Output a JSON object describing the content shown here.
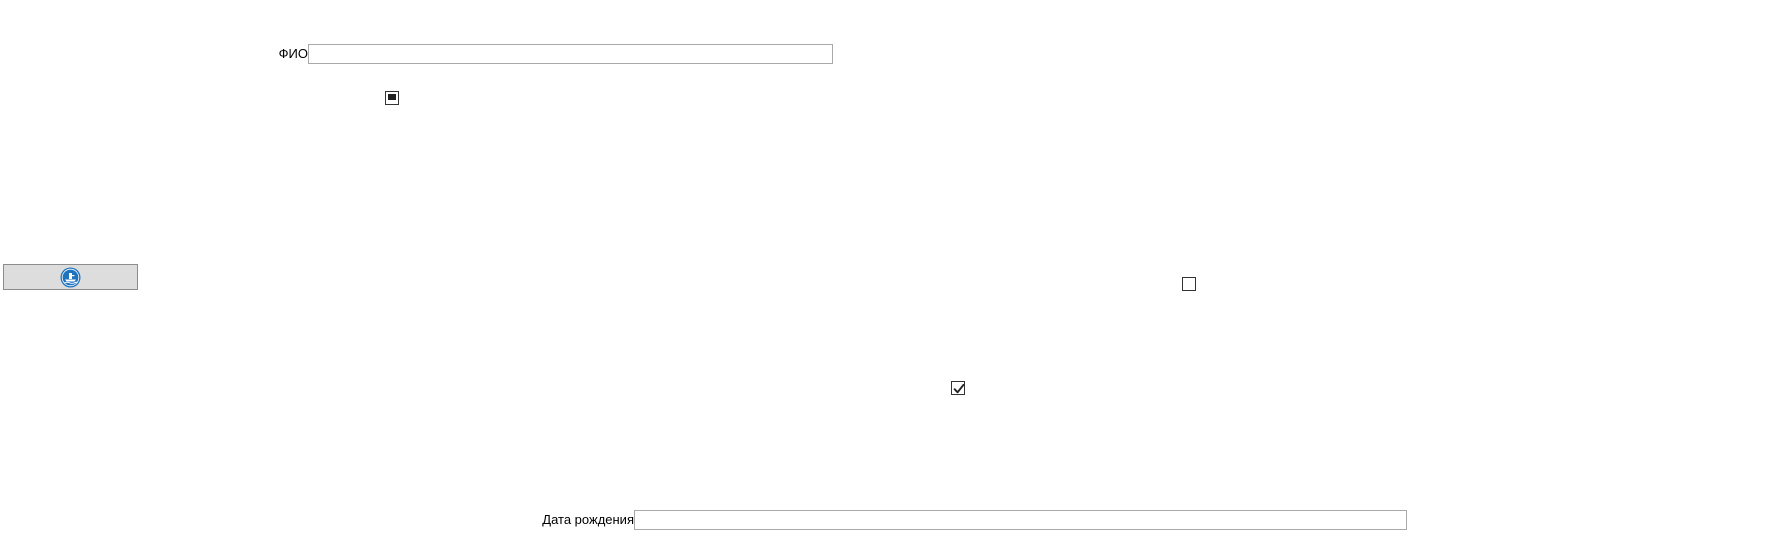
{
  "form": {
    "full_name": {
      "label": "ФИО",
      "value": ""
    },
    "birth_date": {
      "label": "Дата рождения",
      "value": ""
    },
    "checkboxes": [
      {
        "state": "indeterminate"
      },
      {
        "state": "unchecked"
      },
      {
        "state": "checked"
      }
    ],
    "image_button": {
      "icon": "blue-round-emblem-icon",
      "colors": {
        "icon_fill": "#1e73be",
        "icon_glyph": "#ffffff",
        "face": "#dddddd"
      }
    }
  }
}
